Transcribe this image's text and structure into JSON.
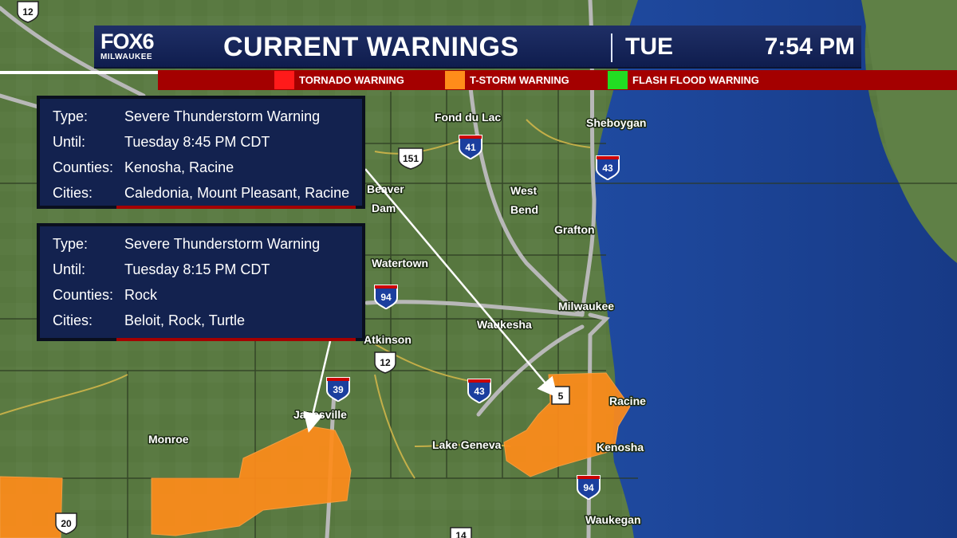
{
  "header": {
    "logo_main": "FOX6",
    "logo_sub": "MILWAUKEE",
    "title": "CURRENT WARNINGS",
    "day": "TUE",
    "time": "7:54 PM"
  },
  "legend": [
    {
      "label": "TORNADO WARNING",
      "color": "#ff1a1a"
    },
    {
      "label": "T-STORM WARNING",
      "color": "#ff8c1a"
    },
    {
      "label": "FLASH FLOOD WARNING",
      "color": "#22dd22"
    }
  ],
  "warnings": [
    {
      "type_label": "Type:",
      "type": "Severe Thunderstorm Warning",
      "until_label": "Until:",
      "until": "Tuesday 8:45 PM CDT",
      "counties_label": "Counties:",
      "counties": "Kenosha, Racine",
      "cities_label": "Cities:",
      "cities": "Caledonia, Mount Pleasant, Racine"
    },
    {
      "type_label": "Type:",
      "type": "Severe Thunderstorm Warning",
      "until_label": "Until:",
      "until": "Tuesday 8:15 PM CDT",
      "counties_label": "Counties:",
      "counties": "Rock",
      "cities_label": "Cities:",
      "cities": "Beloit, Rock, Turtle"
    }
  ],
  "map": {
    "cities": [
      "Fond du Lac",
      "Sheboygan",
      "West",
      "Bend",
      "Beaver",
      "Dam",
      "Grafton",
      "Watertown",
      "Milwaukee",
      "Waukesha",
      "Atkinson",
      "Racine",
      "Janesville",
      "Kenosha",
      "Lake Geneva",
      "Monroe",
      "Waukegan"
    ],
    "shields": {
      "interstate": [
        "41",
        "43",
        "94",
        "43",
        "94",
        "39",
        "5"
      ],
      "us": [
        "12",
        "151",
        "12",
        "20",
        "14"
      ]
    },
    "colors": {
      "land": "#55753f",
      "lake": "#1b3f8f",
      "warning": "#ff8c1a"
    }
  }
}
